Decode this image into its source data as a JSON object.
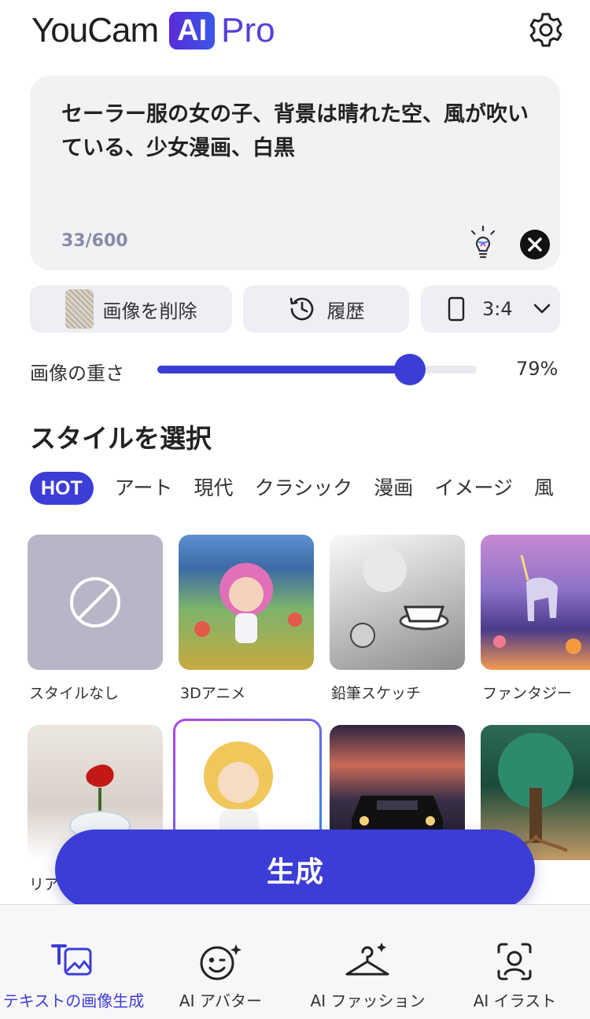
{
  "header": {
    "logo_youcam": "YouCam",
    "logo_ai": "AI",
    "logo_pro": "Pro",
    "settings_icon": "gear-icon"
  },
  "prompt": {
    "text": "セーラー服の女の子、背景は晴れた空、風が吹いている、少女漫画、白黒",
    "count": "33/600"
  },
  "chips": {
    "delete_image": "画像を削除",
    "history": "履歴",
    "ratio": "3:4"
  },
  "image_weight": {
    "label": "画像の重さ",
    "value_text": "79%",
    "value": 0.79
  },
  "styles": {
    "title": "スタイルを選択",
    "tabs": [
      "HOT",
      "アート",
      "現代",
      "クラシック",
      "漫画",
      "イメージ",
      "風"
    ],
    "cards_row1": [
      "スタイルなし",
      "3Dアニメ",
      "鉛筆スケッチ",
      "ファンタジー"
    ],
    "cards_row2_partial_label": "リア"
  },
  "generate_label": "生成",
  "nav": {
    "items": [
      "テキストの画像生成",
      "AI アバター",
      "AI ファッション",
      "AI イラスト"
    ]
  },
  "colors": {
    "accent": "#3c3cd6",
    "prompt_bg": "#f2f2f5",
    "chip_bg": "#eeeef4"
  }
}
